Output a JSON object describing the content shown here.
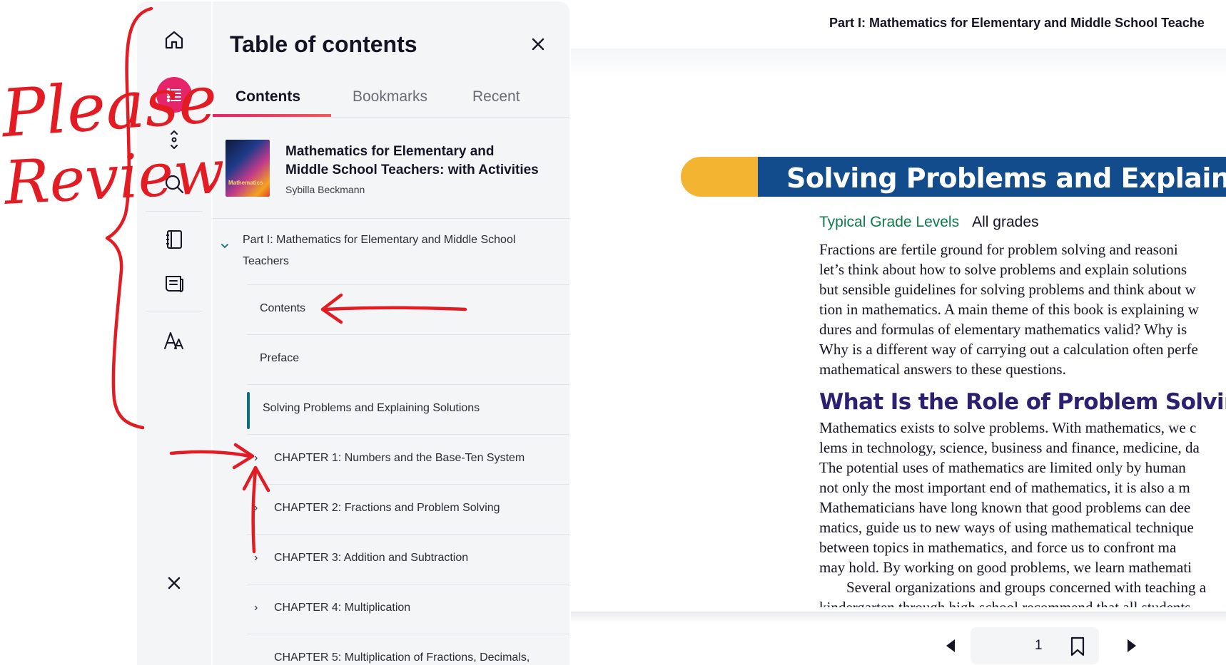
{
  "annotation": {
    "handwriting_line1": "Please",
    "handwriting_line2": "Review",
    "color": "#e31b23"
  },
  "rail": {
    "items": [
      {
        "name": "home-icon"
      },
      {
        "name": "toc-list-icon",
        "active": true
      },
      {
        "name": "expand-collapse-icon"
      },
      {
        "name": "search-icon"
      },
      {
        "name": "notebook-icon"
      },
      {
        "name": "notes-icon"
      },
      {
        "name": "font-size-icon"
      },
      {
        "name": "close-icon"
      }
    ]
  },
  "toc": {
    "title": "Table of contents",
    "tabs": [
      "Contents",
      "Bookmarks",
      "Recent"
    ],
    "active_tab": "Contents",
    "book": {
      "title_line1": "Mathematics for Elementary and",
      "title_line2": "Middle School Teachers: with Activities",
      "author": "Sybilla Beckmann",
      "cover_text": "Mathematics"
    },
    "part": {
      "label_line1": "Part I: Mathematics for Elementary and Middle School",
      "label_line2": "Teachers"
    },
    "items": [
      {
        "label": "Contents"
      },
      {
        "label": "Preface"
      },
      {
        "label": "Solving Problems and Explaining Solutions",
        "active": true
      },
      {
        "label": "CHAPTER 1: Numbers and the Base-Ten System"
      },
      {
        "label": "CHAPTER 2: Fractions and Problem Solving"
      },
      {
        "label": "CHAPTER 3: Addition and Subtraction"
      },
      {
        "label": "CHAPTER 4: Multiplication"
      },
      {
        "label": "CHAPTER 5: Multiplication of Fractions, Decimals,"
      }
    ],
    "accent_color": "#e5246a",
    "active_marker_color": "#0f6f78"
  },
  "reader": {
    "running_head": "Part I: Mathematics for Elementary and Middle School Teache",
    "chapter_title": "Solving Problems and Explaining",
    "grade_label": "Typical Grade Levels",
    "grade_value": "All grades",
    "intro_lines": [
      "Fractions are fertile ground for problem solving and reasoni",
      "let’s think about how to solve problems and explain solutions",
      "but sensible guidelines for solving problems and think about w",
      "tion in mathematics. A main theme of this book is explaining w",
      "dures and formulas of elementary mathematics valid? Why is",
      "Why is a different way of carrying out a calculation often perfe",
      "mathematical answers to these questions."
    ],
    "section_heading": "What Is the Role of Problem Solving?",
    "body_lines": [
      "Mathematics exists to solve problems. With mathematics, we c",
      "lems in technology, science, business and finance, medicine, da",
      "The potential uses of mathematics are limited only by human",
      "not only the most important end of mathematics, it is also a m",
      "Mathematicians have long known that good problems can dee",
      "matics, guide us to new ways of using mathematical technique",
      "between topics in mathematics, and force us to confront ma",
      "may hold. By working on good problems, we learn mathemati",
      "Several organizations and groups concerned with teaching a",
      "kindergarten through high school recommend that all students"
    ],
    "banner_colors": {
      "pill": "#f2b431",
      "bar": "#134c8c"
    },
    "heading_color": "#2d2070",
    "grade_color": "#0e7a4a",
    "page_number": "1"
  }
}
